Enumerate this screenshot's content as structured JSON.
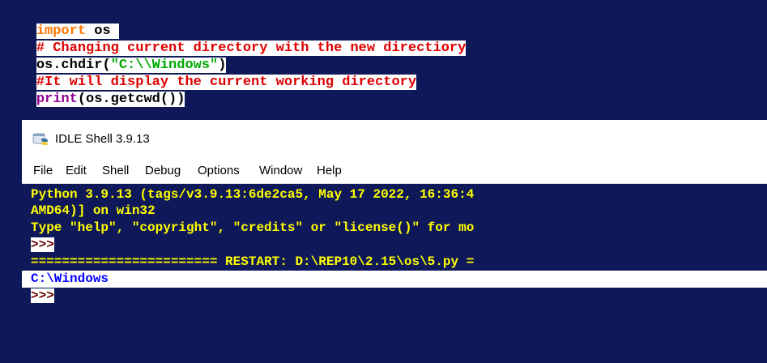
{
  "editor": {
    "line1": {
      "kw": "import",
      "rest": " os "
    },
    "line2": {
      "comment": "# Changing current directory with the new directiory"
    },
    "line3": {
      "pre": "os.chdir(",
      "str": "\"C:\\\\Windows\"",
      "post": ")"
    },
    "line4": {
      "comment": "#It will display the current working directory"
    },
    "line5": {
      "builtin": "print",
      "rest": "(os.getcwd())"
    }
  },
  "idle": {
    "title": "IDLE Shell 3.9.13",
    "menu": [
      "File",
      "Edit",
      "Shell",
      "Debug",
      "Options",
      "Window",
      "Help"
    ],
    "banner1": "Python 3.9.13 (tags/v3.9.13:6de2ca5, May 17 2022, 16:36:4",
    "banner2": "AMD64)] on win32",
    "banner3": "Type \"help\", \"copyright\", \"credits\" or \"license()\" for mo",
    "prompt": ">>>",
    "restart": "======================== RESTART: D:\\REP10\\2.15\\os\\5.py =",
    "output": "C:\\Windows",
    "prompt2": ">>>"
  },
  "colors": {
    "background": "#0f1858",
    "keyword": "#ff7700",
    "comment": "#dd0000",
    "string": "#00aa00",
    "shell_text": "#ffff00",
    "output": "#0000ff"
  }
}
